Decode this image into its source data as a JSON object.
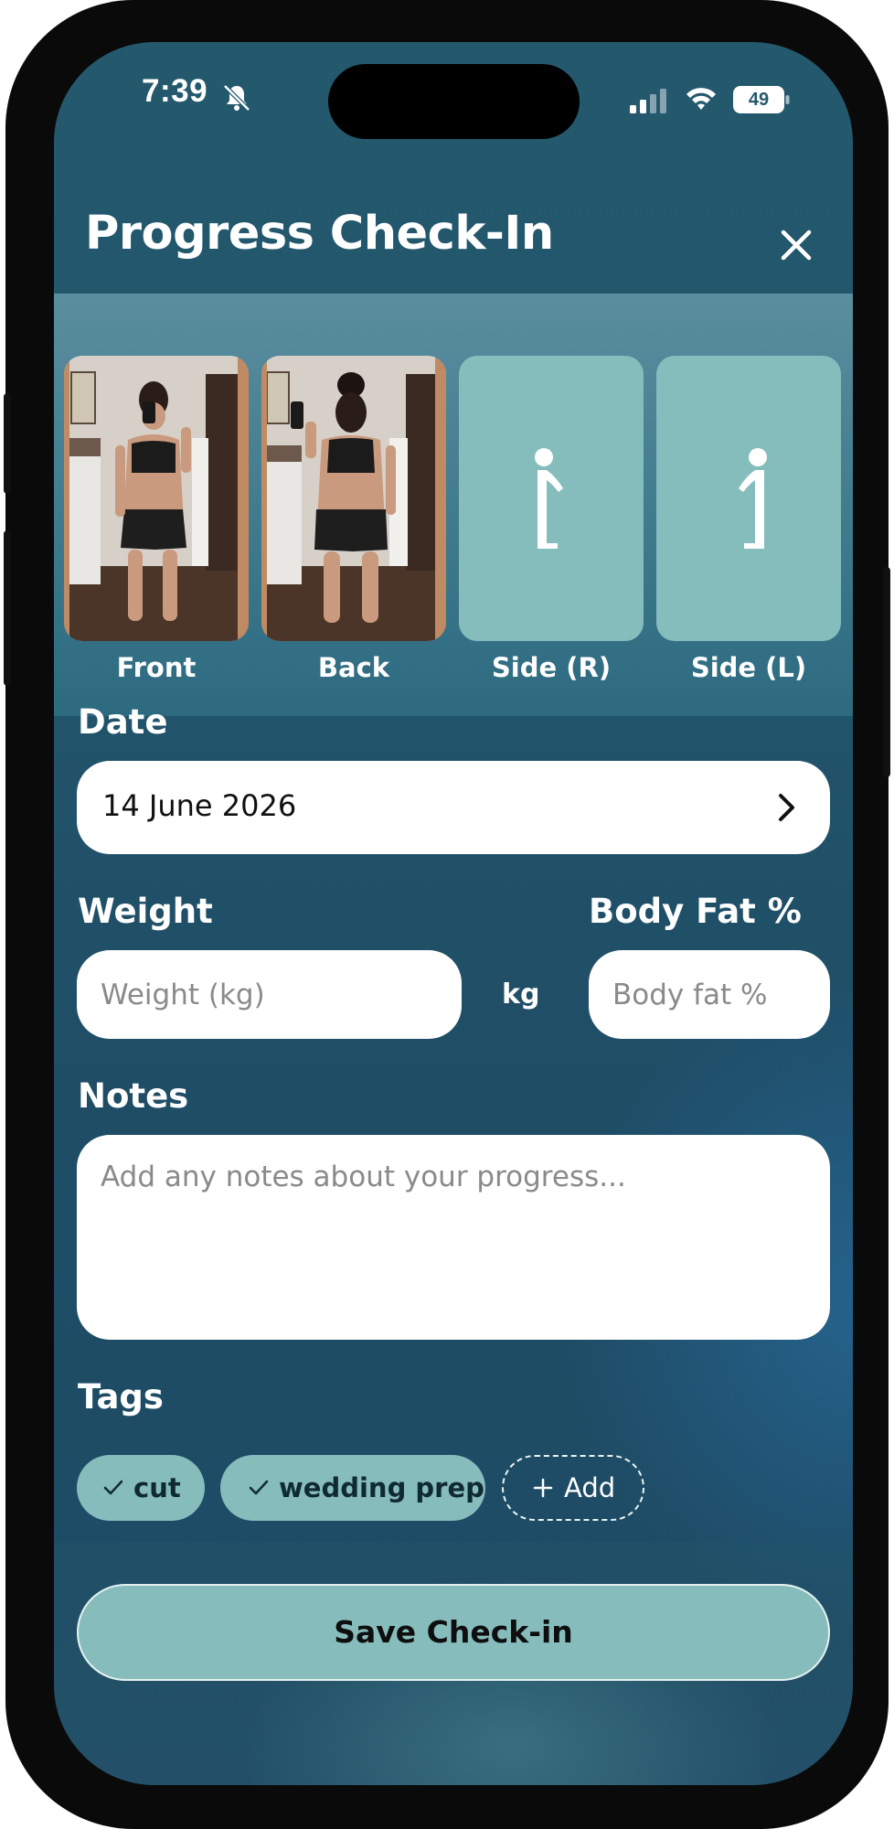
{
  "status_bar": {
    "time": "7:39",
    "battery": "49",
    "icons": [
      "bell-slash-icon",
      "signal-icon",
      "wifi-icon",
      "battery-icon"
    ]
  },
  "header": {
    "title": "Progress Check-In",
    "close_icon": "close-icon"
  },
  "photos": [
    {
      "label": "Front",
      "state": "photo"
    },
    {
      "label": "Back",
      "state": "photo"
    },
    {
      "label": "Side (R)",
      "state": "empty"
    },
    {
      "label": "Side (L)",
      "state": "empty"
    }
  ],
  "date": {
    "label": "Date",
    "value": "14 June 2026"
  },
  "weight": {
    "label": "Weight",
    "placeholder": "Weight (kg)",
    "value": "",
    "unit": "kg"
  },
  "body_fat": {
    "label": "Body Fat %",
    "placeholder": "Body fat %",
    "value": ""
  },
  "notes": {
    "label": "Notes",
    "placeholder": "Add any notes about your progress...",
    "value": ""
  },
  "tags": {
    "label": "Tags",
    "items": [
      {
        "label": "cut",
        "selected": true
      },
      {
        "label": "wedding prep",
        "selected": true
      }
    ],
    "add_label": "Add"
  },
  "actions": {
    "save_label": "Save Check-in"
  },
  "colors": {
    "background": "#22566c",
    "accent": "#86bcbb",
    "text": "#ffffff"
  }
}
